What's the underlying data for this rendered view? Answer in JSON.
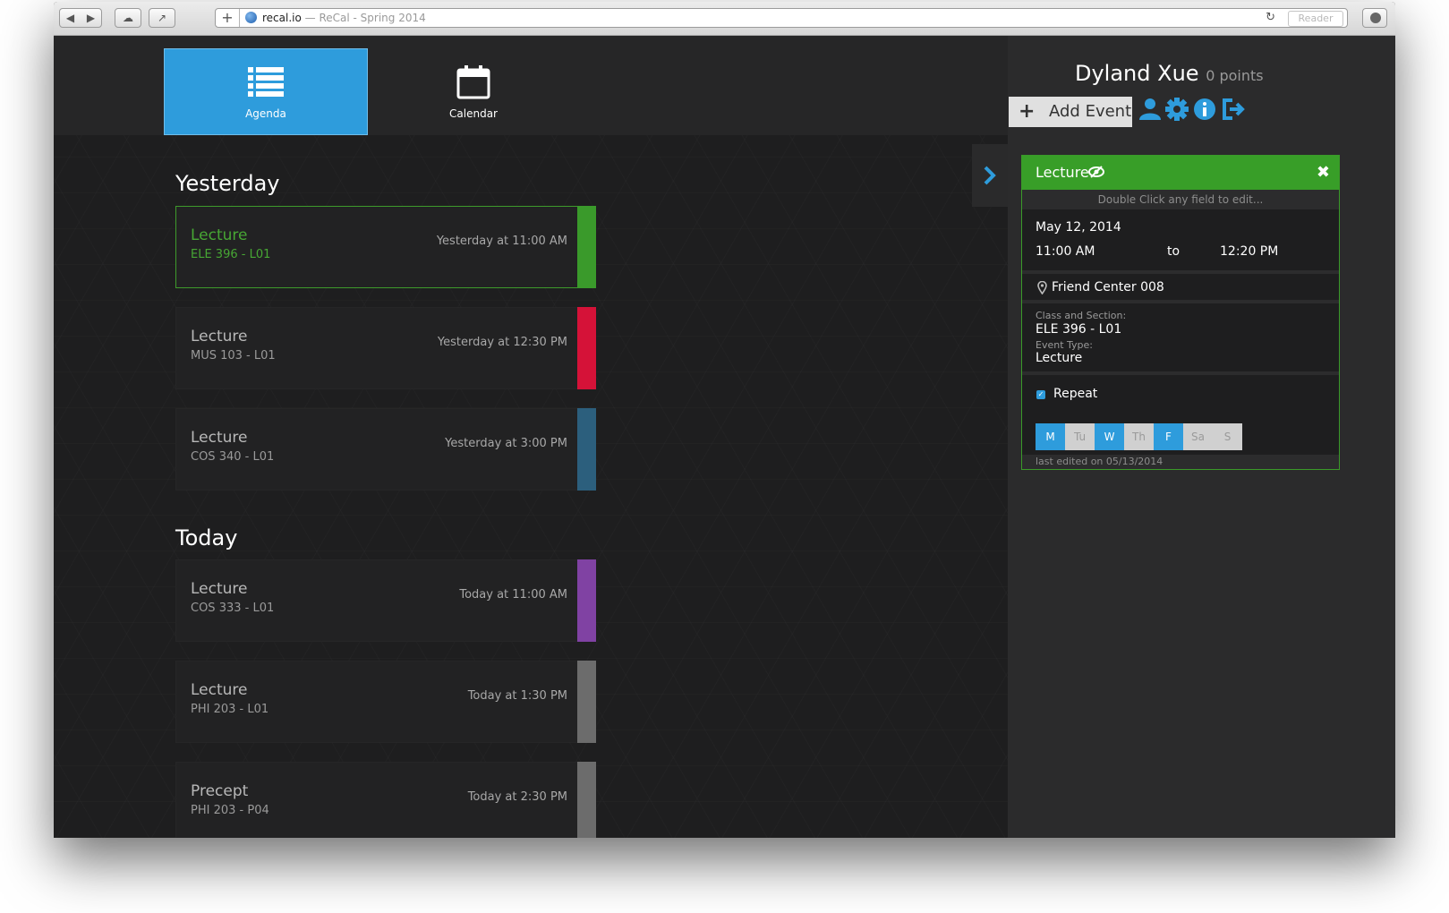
{
  "browser": {
    "host": "recal.io",
    "separator": " — ",
    "page_title": "ReCal - Spring 2014",
    "reader_label": "Reader"
  },
  "nav": {
    "tabs": [
      {
        "label": "Agenda",
        "icon": "list-icon",
        "active": true
      },
      {
        "label": "Calendar",
        "icon": "calendar-icon",
        "active": false
      }
    ]
  },
  "agenda": {
    "sections": [
      {
        "title": "Yesterday",
        "events": [
          {
            "name": "Lecture",
            "course": "ELE 396 - L01",
            "time": "Yesterday at 11:00 AM",
            "color": "#3a9a2b",
            "selected": true
          },
          {
            "name": "Lecture",
            "course": "MUS 103 - L01",
            "time": "Yesterday at 12:30 PM",
            "color": "#d51238"
          },
          {
            "name": "Lecture",
            "course": "COS 340 - L01",
            "time": "Yesterday at 3:00 PM",
            "color": "#2c5f7d"
          }
        ]
      },
      {
        "title": "Today",
        "events": [
          {
            "name": "Lecture",
            "course": "COS 333 - L01",
            "time": "Today at 11:00 AM",
            "color": "#8042a3"
          },
          {
            "name": "Lecture",
            "course": "PHI 203 - L01",
            "time": "Today at 1:30 PM",
            "color": "#6c6c6c"
          },
          {
            "name": "Precept",
            "course": "PHI 203 - P04",
            "time": "Today at 2:30 PM",
            "color": "#6c6c6c"
          }
        ]
      }
    ]
  },
  "user": {
    "name": "Dyland Xue",
    "points": "0 points",
    "add_event_label": "Add Event",
    "icons": [
      "user-icon",
      "gear-icon",
      "info-icon",
      "logout-icon"
    ]
  },
  "event_panel": {
    "title": "Lecture",
    "hint": "Double Click any field to edit...",
    "date": "May 12, 2014",
    "start_time": "11:00 AM",
    "to_label": "to",
    "end_time": "12:20 PM",
    "location": "Friend Center 008",
    "class_section_label": "Class and Section:",
    "class_section": "ELE 396 - L01",
    "event_type_label": "Event Type:",
    "event_type": "Lecture",
    "repeat_label": "Repeat",
    "repeat_checked": true,
    "days": [
      {
        "label": "M",
        "on": true
      },
      {
        "label": "Tu",
        "on": false
      },
      {
        "label": "W",
        "on": true
      },
      {
        "label": "Th",
        "on": false
      },
      {
        "label": "F",
        "on": true
      },
      {
        "label": "Sa",
        "on": false
      },
      {
        "label": "S",
        "on": false
      }
    ],
    "last_edited": "last edited on 05/13/2014"
  },
  "colors": {
    "accent_blue": "#2e9cdc",
    "accent_green": "#389e28",
    "background": "#1e1e1f"
  }
}
